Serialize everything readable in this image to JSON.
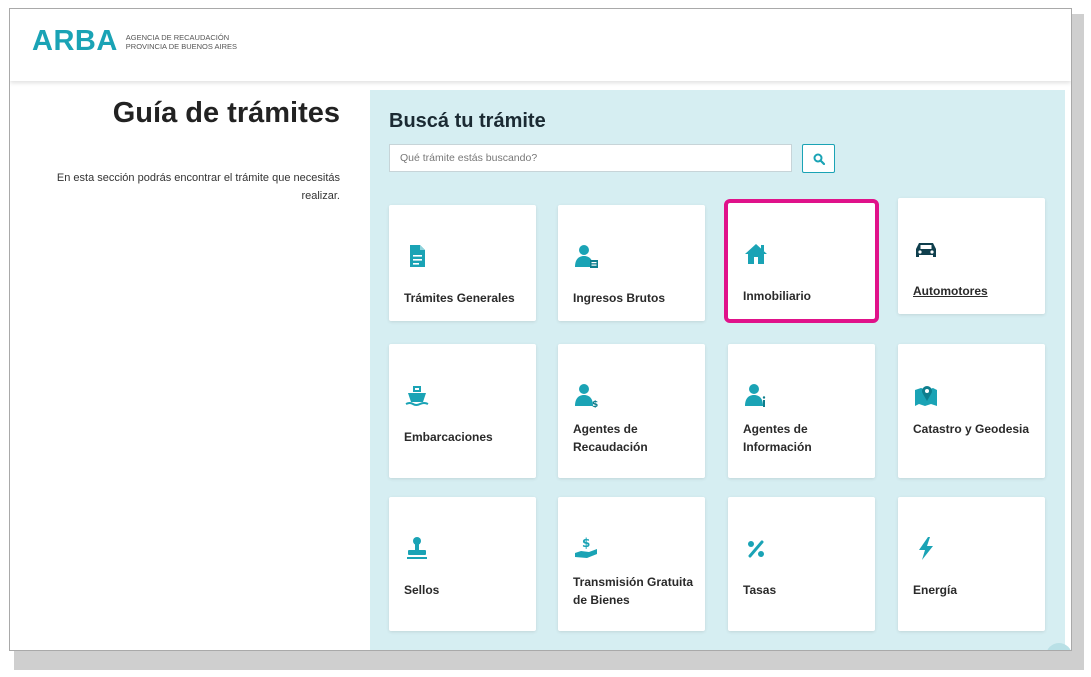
{
  "header": {
    "logo": "ARBA",
    "agency_line1": "AGENCIA DE RECAUDACIÓN",
    "agency_line2": "PROVINCIA DE BUENOS AIRES"
  },
  "intro": {
    "title": "Guía de trámites",
    "description": "En esta sección podrás encontrar el trámite que necesitás realizar."
  },
  "search": {
    "title": "Buscá tu trámite",
    "placeholder": "Qué trámite estás buscando?",
    "button_icon": "search-icon"
  },
  "accent_color": "#1aa3b5",
  "highlight_color": "#e0128a",
  "cards": [
    {
      "label": "Trámites Generales",
      "icon": "document-icon"
    },
    {
      "label": "Ingresos Brutos",
      "icon": "person-document-icon"
    },
    {
      "label": "Inmobiliario",
      "icon": "house-icon",
      "highlighted": true
    },
    {
      "label": "Automotores",
      "icon": "car-icon",
      "underlined": true
    },
    {
      "label": "Embarcaciones",
      "icon": "ship-icon"
    },
    {
      "label": "Agentes de Recaudación",
      "icon": "person-dollar-icon"
    },
    {
      "label": "Agentes de Información",
      "icon": "person-info-icon"
    },
    {
      "label": "Catastro y Geodesia",
      "icon": "map-marker-icon"
    },
    {
      "label": "Sellos",
      "icon": "stamp-icon"
    },
    {
      "label": "Transmisión Gratuita de Bienes",
      "icon": "hand-dollar-icon"
    },
    {
      "label": "Tasas",
      "icon": "percent-icon"
    },
    {
      "label": "Energía",
      "icon": "bolt-icon"
    }
  ]
}
